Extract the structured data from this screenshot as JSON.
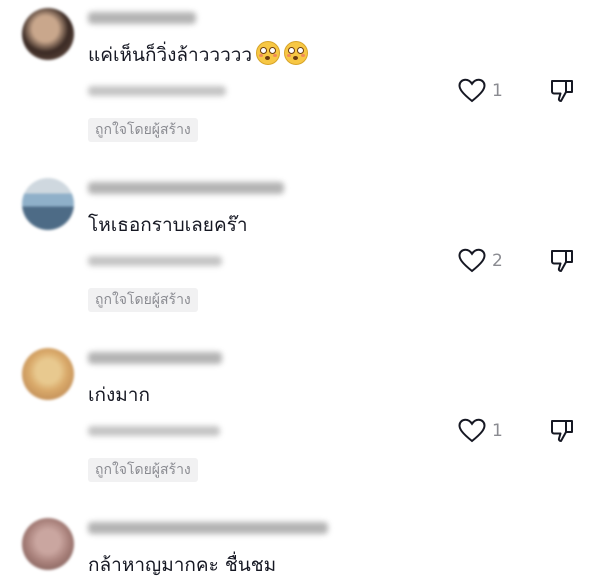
{
  "comments": [
    {
      "text": "แค่เห็นก็วิ่งล้าววววว",
      "emojis": [
        "flushed-face",
        "flushed-face"
      ],
      "like_count": "1",
      "badge": "ถูกใจโดยผู้สร้าง",
      "avatar_colors": [
        "#3a2a24",
        "#c9a78c",
        "#6b5245"
      ]
    },
    {
      "text": "โหเธอกราบเลยคร๊า",
      "like_count": "2",
      "badge": "ถูกใจโดยผู้สร้าง",
      "avatar_colors": [
        "#8fb0c9",
        "#4d6b86",
        "#cfd8df"
      ]
    },
    {
      "text": "เก่งมาก",
      "like_count": "1",
      "badge": "ถูกใจโดยผู้สร้าง",
      "avatar_colors": [
        "#d9a96a",
        "#b07a4a",
        "#e8c98f"
      ]
    },
    {
      "text": "กล้าหาญมากคะ ชื่นชม",
      "avatar_colors": [
        "#a8807a",
        "#6e4f4a",
        "#caa6a0"
      ]
    }
  ],
  "icons": {
    "like": "heart-outline-icon",
    "dislike": "thumbs-down-outline-icon"
  },
  "colors": {
    "text": "#161823",
    "muted": "#8a8b91",
    "badge_bg": "#f1f1f2"
  }
}
